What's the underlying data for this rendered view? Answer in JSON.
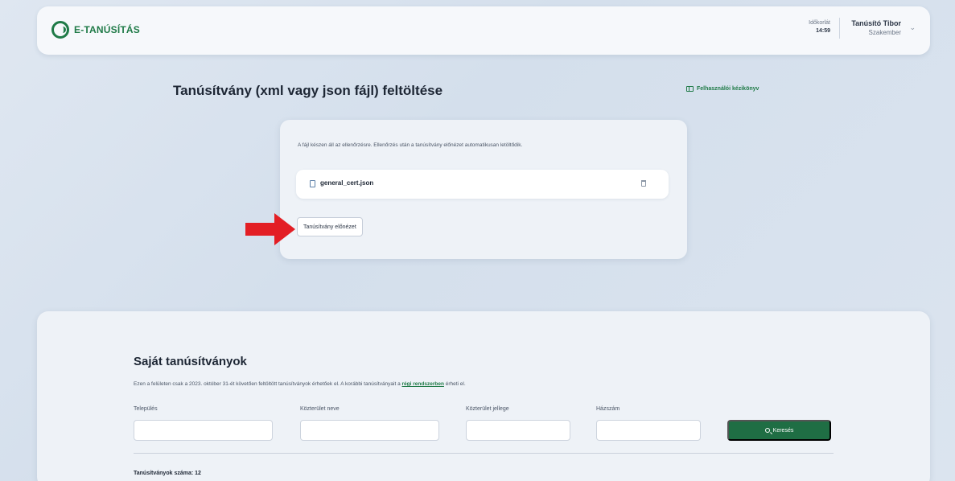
{
  "header": {
    "brand": "E-TANÚSÍTÁS",
    "timer_label": "Időkorlát",
    "timer_value": "14:59",
    "user_name": "Tanúsító Tibor",
    "user_role": "Szakember"
  },
  "page": {
    "title": "Tanúsítvány (xml vagy json fájl) feltöltése",
    "manual_link": "Felhasználói kézikönyv"
  },
  "upload": {
    "message": "A fájl készen áll az ellenőrzésre. Ellenőrzés után a tanúsítvány előnézet automatikusan letöltődik.",
    "file_name": "general_cert.json",
    "preview_button": "Tanúsítvány előnézet"
  },
  "annotation": {
    "arrow_color": "#e31e24"
  },
  "list": {
    "title": "Saját tanúsítványok",
    "desc_before": "Ezen a felületen csak a 2023. október 31-ét követően feltöltött tanúsítványok érhetőek el. A korábbi tanúsítványait a ",
    "desc_link": "régi rendszerben",
    "desc_after": " érheti el.",
    "filters": {
      "settlement_label": "Település",
      "street_label": "Közterület neve",
      "street_type_label": "Közterület jellege",
      "house_number_label": "Házszám"
    },
    "search_button": "Keresés",
    "count_text": "Tanúsítványok száma: 12"
  },
  "colors": {
    "brand_green": "#1f7a47",
    "button_green": "#1f6e44"
  }
}
